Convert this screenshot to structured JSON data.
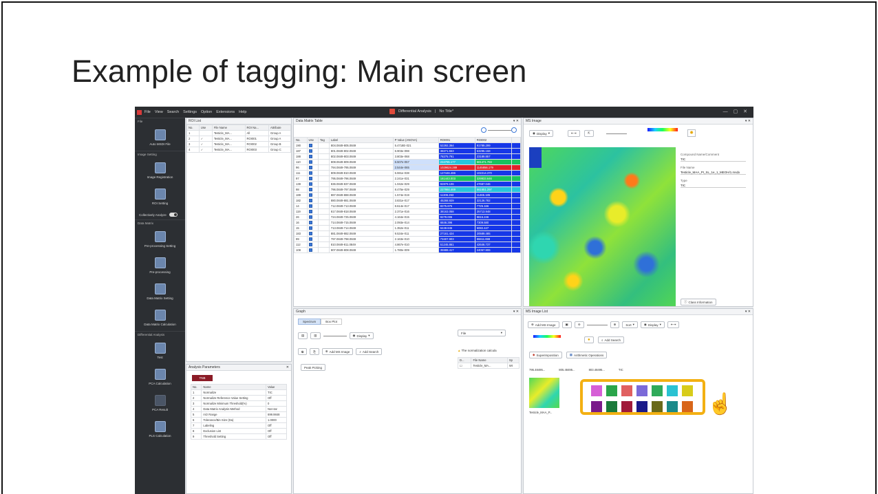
{
  "slide": {
    "title": "Example of tagging: Main screen"
  },
  "app": {
    "menu": [
      "File",
      "View",
      "Search",
      "Settings",
      "Option",
      "Extensions",
      "Help"
    ],
    "window_title": "Differential Analysis",
    "doc_title": "No Title*",
    "sidebar": {
      "sections": [
        "File",
        "Image Setting",
        "Data Matrix",
        "Differential Analysis"
      ],
      "buttons": [
        "Auto MSDI File",
        "Image Registration",
        "ROI Setting",
        "Pre-processing Setting",
        "Pre-processing",
        "Data Matrix Setting",
        "Data Matrix Calculation",
        "Test",
        "PCA Calculation",
        "PCA Result",
        "PLS Calculation"
      ],
      "toggle_label": "Collectively Analyze"
    },
    "roi_list": {
      "tab": "ROI List",
      "headers": [
        "No.",
        "Use",
        "File Name",
        "ROI Na...",
        "Attribute"
      ],
      "rows": [
        [
          "1",
          "",
          "Testicle_MA...",
          "All",
          "Group A"
        ],
        [
          "2",
          "✓",
          "Testicle_MA...",
          "ROI001",
          "Group A"
        ],
        [
          "3",
          "✓",
          "Testicle_MA...",
          "ROI002",
          "Group B"
        ],
        [
          "4",
          "✓",
          "Testicle_MA...",
          "ROI003",
          "Group C"
        ]
      ]
    },
    "analysis_params": {
      "title": "Analysis Parameters",
      "badge": "TNB",
      "headers": [
        "No.",
        "Name",
        "Value"
      ],
      "rows": [
        [
          "1",
          "Normalize",
          "TIC"
        ],
        [
          "2",
          "Normalize Reference Value Setting",
          "Off"
        ],
        [
          "3",
          "Normalize Minimum Threshold(%)",
          "0"
        ],
        [
          "4",
          "Data Matrix Analysis Method",
          "Non-tar"
        ],
        [
          "5",
          "m/z Range",
          "699.9848"
        ],
        [
          "6",
          "Tolerance/Bin Size (Da)",
          "1.0000"
        ],
        [
          "7",
          "Labeling",
          "Off"
        ],
        [
          "8",
          "Exclusion List",
          "Off"
        ],
        [
          "9",
          "Threshold Setting",
          "Off"
        ]
      ]
    },
    "data_matrix": {
      "title": "Data Matrix Table",
      "headers": [
        "No.",
        "Use",
        "Tag",
        "Label",
        "P Value (ANOVA)",
        "ROI001",
        "ROI002"
      ],
      "rows": [
        [
          "190",
          "804.0849-805.0849",
          "5.4718E-021",
          "52292.364",
          "91789.299"
        ],
        [
          "187",
          "801.0849-802.0849",
          "6.903e-098",
          "38271.553",
          "53295.158"
        ],
        [
          "188",
          "802.0849-803.0849",
          "3.803e-068",
          "78275.791",
          "23189.857"
        ],
        [
          "110",
          "808.0649-809.0849",
          "6.507e-057",
          "234785.177",
          "581471.783"
        ],
        [
          "96",
          "794.0849-795.0849",
          "2.544e-065",
          "1029624.289",
          "1145856.179"
        ],
        [
          "111",
          "809.0849-810.0849",
          "5.591e-038",
          "127446.486",
          "102214.370"
        ],
        [
          "97",
          "795.0849-796.0849",
          "2.241e-031",
          "161443.003",
          "329933.646"
        ],
        [
          "139",
          "836.0849-837.0849",
          "1.042e-029",
          "92879.106",
          "47687.046"
        ],
        [
          "98",
          "796.0849-797.0849",
          "8.475e-029",
          "227984.469",
          "561651.297"
        ],
        [
          "189",
          "887.0849-888.0849",
          "1.574e-019",
          "11306.263",
          "11465.185"
        ],
        [
          "182",
          "880.0849-881.0849",
          "3.831e-017",
          "45268.929",
          "32126.782"
        ],
        [
          "14",
          "712.0849-713.0849",
          "8.614e-017",
          "8275.875",
          "7725.166"
        ],
        [
          "119",
          "817.0849-818.0849",
          "2.371e-016",
          "38163.058",
          "25713.948"
        ],
        [
          "26",
          "724.0849-725.0849",
          "4.164e-015",
          "9278.006",
          "9815.246"
        ],
        [
          "16",
          "714.0849-715.0849",
          "2.093e-014",
          "6846.396",
          "7309.580"
        ],
        [
          "15",
          "713.0849-714.0849",
          "1.352e-011",
          "6449.845",
          "6082.447"
        ],
        [
          "183",
          "881.0849-882.0849",
          "9.534e-011",
          "27161.424",
          "20589.485"
        ],
        [
          "99",
          "797.0849-798.0849",
          "2.163e-010",
          "73407.903",
          "86611.698"
        ],
        [
          "112",
          "810.0849-811.0849",
          "4.867e-010",
          "51245.861",
          "42646.737"
        ],
        [
          "108",
          "807.0849-808.0849",
          "1.780e-009",
          "35988.417",
          "24057.906"
        ]
      ]
    },
    "ms_image": {
      "title": "MS Image",
      "display_btn": "Display",
      "compound_label": "Compound Name/Comment",
      "compound_value": "TIC",
      "file_label": "File Name",
      "file_value": "Testicle_MAA_PI_SL_1e_1_MEOH/1.msdx",
      "type_label": "Type",
      "type_value": "TIC",
      "class_btn": "Class Information"
    },
    "graph": {
      "title": "Graph",
      "tabs": [
        "Spectrum",
        "Box Plot"
      ],
      "display_btn": "Display",
      "add_ms_image": "Add MS Image",
      "add_search": "Add Search",
      "peak_picking": "Peak Picking",
      "file_select": "File",
      "normalization_note": "The normalization calcula",
      "file_headers": [
        "D...",
        "File Name",
        "Sp"
      ],
      "file_row": [
        "Testicle_MA...",
        "Wt"
      ]
    },
    "ms_image_list": {
      "title": "MS Image List",
      "add_btn": "Add MS Image",
      "sort_btn": "Sort",
      "display_btn": "Display",
      "add_search": "Add Search",
      "superimposition": "Superimposition",
      "arithmetic": "Arithmetic Operations",
      "thumb_labels": [
        "795.48495...",
        "805.48495...",
        "803.48495...",
        "TIC"
      ],
      "thumb_name": "Testicle_MAA_P..."
    },
    "tag_colors": {
      "row1": [
        "#d65fd6",
        "#2aa54a",
        "#e06060",
        "#7b6ad8",
        "#2faa5a",
        "#2ac2d2",
        "#d8cc1a"
      ],
      "row2": [
        "#7a1a8a",
        "#1a7a3a",
        "#a01a3a",
        "#1a1a8a",
        "#6a6a1a",
        "#1a8a8a",
        "#d8661a"
      ]
    }
  }
}
